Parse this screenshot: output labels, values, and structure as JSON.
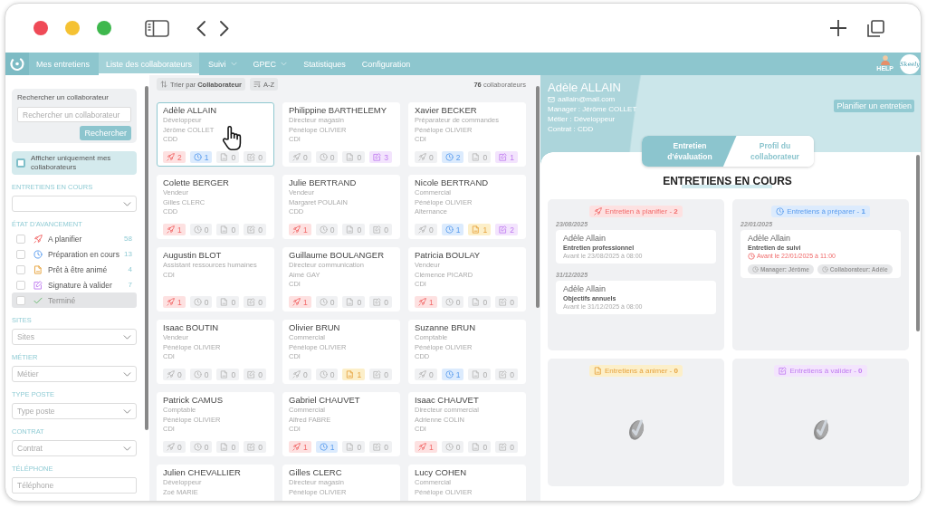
{
  "nav": {
    "items": [
      {
        "label": "Mes entretiens",
        "selected": false,
        "menu": false
      },
      {
        "label": "Liste des collaborateurs",
        "selected": true,
        "menu": false
      },
      {
        "label": "Suivi",
        "selected": false,
        "menu": true
      },
      {
        "label": "GPEC",
        "selected": false,
        "menu": true
      },
      {
        "label": "Statistiques",
        "selected": false,
        "menu": false
      },
      {
        "label": "Configuration",
        "selected": false,
        "menu": false
      }
    ],
    "help": "HELP",
    "brand": "Skeely"
  },
  "sidebar": {
    "search": {
      "title": "Rechercher un collaborateur",
      "placeholder": "Rechercher un collaborateur",
      "button": "Rechercher"
    },
    "only_mine": {
      "label": "Afficher uniquement mes collaborateurs",
      "checked": false
    },
    "filters": [
      {
        "kind": "select",
        "label": "ENTRETIENS EN COURS"
      },
      {
        "kind": "checklist",
        "label": "ÉTAT D'AVANCEMENT",
        "items": [
          {
            "kind": "plan",
            "label": "A planifier",
            "count": "58",
            "checked": false,
            "disabled": false
          },
          {
            "kind": "prepare",
            "label": "Préparation en cours",
            "count": "13",
            "checked": false,
            "disabled": false
          },
          {
            "kind": "animate",
            "label": "Prêt à être animé",
            "count": "4",
            "checked": false,
            "disabled": false
          },
          {
            "kind": "sign",
            "label": "Signature à valider",
            "count": "7",
            "checked": false,
            "disabled": false
          },
          {
            "kind": "done",
            "label": "Terminé",
            "checked": false,
            "disabled": true
          }
        ]
      },
      {
        "kind": "select",
        "label": "SITES",
        "placeholder": "Sites"
      },
      {
        "kind": "select",
        "label": "MÉTIER",
        "placeholder": "Métier"
      },
      {
        "kind": "select",
        "label": "TYPE POSTE",
        "placeholder": "Type poste"
      },
      {
        "kind": "select",
        "label": "CONTRAT",
        "placeholder": "Contrat"
      },
      {
        "kind": "input",
        "label": "TÉLÉPHONE",
        "placeholder": "Téléphone"
      }
    ]
  },
  "list": {
    "sort": "Trier par **Collaborateur**",
    "order": "A-Z",
    "total": "**76** collaborateurs",
    "cards": [
      {
        "name": "Adèle ALLAIN",
        "details": [
          "Développeur",
          "Jérôme COLLET",
          "CDD"
        ],
        "counts": [
          "2",
          "1",
          "0",
          "0"
        ],
        "selected": true
      },
      {
        "name": "Philippine BARTHELEMY",
        "details": [
          "Directeur magasin",
          "Pénélope OLIVIER",
          "CDI"
        ],
        "counts": [
          "0",
          "0",
          "0",
          "3"
        ],
        "selected": false
      },
      {
        "name": "Xavier BECKER",
        "details": [
          "Préparateur de commandes",
          "Pénélope OLIVIER",
          "CDI"
        ],
        "counts": [
          "0",
          "2",
          "0",
          "1"
        ],
        "selected": false
      },
      {
        "name": "Colette BERGER",
        "details": [
          "Vendeur",
          "Gilles CLERC",
          "CDD"
        ],
        "counts": [
          "1",
          "0",
          "0",
          "0"
        ],
        "selected": false
      },
      {
        "name": "Julie BERTRAND",
        "details": [
          "Vendeur",
          "Margaret POULAIN",
          "CDD"
        ],
        "counts": [
          "1",
          "0",
          "0",
          "0"
        ],
        "selected": false
      },
      {
        "name": "Nicole BERTRAND",
        "details": [
          "Commercial",
          "Pénélope OLIVIER",
          "Alternance"
        ],
        "counts": [
          "0",
          "1",
          "1",
          "2"
        ],
        "selected": false
      },
      {
        "name": "Augustin BLOT",
        "details": [
          "Assistant ressources humaines",
          "CDI"
        ],
        "counts": [
          "1",
          "0",
          "0",
          "0"
        ],
        "selected": false
      },
      {
        "name": "Guillaume BOULANGER",
        "details": [
          "Directeur communication",
          "Aimé GAY",
          "CDI"
        ],
        "counts": [
          "1",
          "0",
          "0",
          "0"
        ],
        "selected": false
      },
      {
        "name": "Patricia BOULAY",
        "details": [
          "Vendeur",
          "Clémence PICARD",
          "CDI"
        ],
        "counts": [
          "1",
          "0",
          "0",
          "0"
        ],
        "selected": false
      },
      {
        "name": "Isaac BOUTIN",
        "details": [
          "Vendeur",
          "Pénélope OLIVIER",
          "CDI"
        ],
        "counts": [
          "0",
          "0",
          "0",
          "0"
        ],
        "selected": false
      },
      {
        "name": "Olivier BRUN",
        "details": [
          "Commercial",
          "Pénélope OLIVIER",
          "CDI"
        ],
        "counts": [
          "0",
          "0",
          "1",
          "0"
        ],
        "selected": false
      },
      {
        "name": "Suzanne BRUN",
        "details": [
          "Comptable",
          "Pénélope OLIVIER",
          "CDD"
        ],
        "counts": [
          "0",
          "1",
          "0",
          "0"
        ],
        "selected": false
      },
      {
        "name": "Patrick CAMUS",
        "details": [
          "Comptable",
          "Pénélope OLIVIER",
          "CDI"
        ],
        "counts": [
          "0",
          "0",
          "0",
          "0"
        ],
        "selected": false
      },
      {
        "name": "Gabriel CHAUVET",
        "details": [
          "Commercial",
          "Alfred FABRE",
          "CDI"
        ],
        "counts": [
          "1",
          "1",
          "0",
          "0"
        ],
        "selected": false
      },
      {
        "name": "Isaac CHAUVET",
        "details": [
          "Directeur commercial",
          "Adrienne COLIN",
          "CDI"
        ],
        "counts": [
          "1",
          "0",
          "0",
          "0"
        ],
        "selected": false
      },
      {
        "name": "Julien CHEVALLIER",
        "details": [
          "Développeur",
          "Zoé MARIE"
        ],
        "selected": false
      },
      {
        "name": "Gilles CLERC",
        "details": [
          "Directeur magasin",
          "Pénélope OLIVIER"
        ],
        "selected": false
      },
      {
        "name": "Lucy COHEN",
        "details": [
          "Commercial",
          "Pénélope OLIVIER"
        ],
        "selected": false
      }
    ]
  },
  "profile": {
    "name": "Adèle ALLAIN",
    "email": "aallain@mail.com",
    "details": [
      "Manager : Jérôme COLLET",
      "Métier : Développeur",
      "Contrat : CDD"
    ],
    "action": "Planifier un entretien",
    "tabs": [
      {
        "label": "Entretien d'évaluation",
        "selected": true
      },
      {
        "label": "Profil du collaborateur",
        "selected": false
      }
    ],
    "heading": "ENTRETIENS EN COURS",
    "columns": [
      {
        "kind": "plan",
        "title": "Entretien à planifier - **2**",
        "groups": [
          {
            "date": "23/08/2025",
            "items": [
              {
                "person": "Adèle Allain",
                "type": "Entretien professionnel",
                "deadline": "Avant le 23/08/2025 à 08:00",
                "overdue": false
              }
            ]
          },
          {
            "date": "31/12/2025",
            "items": [
              {
                "person": "Adèle Allain",
                "type": "Objectifs annuels",
                "deadline": "Avant le 31/12/2025 à 08:00",
                "overdue": false
              }
            ]
          }
        ]
      },
      {
        "kind": "prepare",
        "title": "Entretiens à préparer - **1**",
        "groups": [
          {
            "date": "22/01/2025",
            "items": [
              {
                "person": "Adèle Allain",
                "type": "Entretien de suivi",
                "deadline": "Avant le 22/01/2025 à 11:00",
                "overdue": true,
                "tags": [
                  "Manager: Jérôme",
                  "Collaborateur: Adèle"
                ]
              }
            ]
          }
        ]
      },
      {
        "kind": "animate",
        "title": "Entretiens à animer - **0**"
      },
      {
        "kind": "sign",
        "title": "Entretiens à valider - **0**"
      }
    ]
  }
}
